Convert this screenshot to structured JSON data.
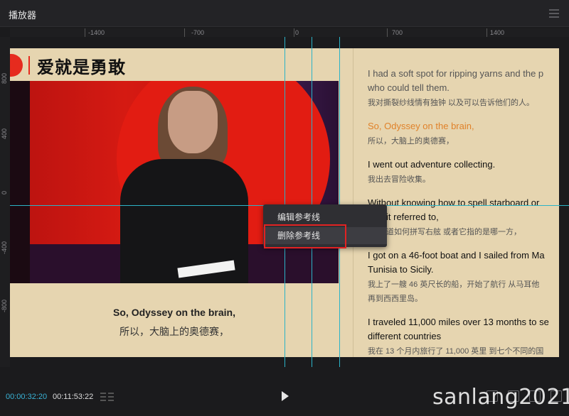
{
  "window": {
    "title": "播放器"
  },
  "ruler": {
    "top_ticks": [
      "-1400",
      "-700",
      "0",
      "700",
      "1400"
    ],
    "left_ticks": [
      "800",
      "400",
      "0",
      "-400",
      "-800"
    ]
  },
  "video": {
    "heading": "爱就是勇敢",
    "subtitle_en": "So, Odyssey on the brain,",
    "subtitle_zh": "所以，大脑上的奥德赛，"
  },
  "transcript": [
    {
      "en": "I had a soft spot for ripping yarns and the p",
      "en2": "who could tell them.",
      "zh": "我对撕裂纱线情有独钟 以及可以告诉他们的人。",
      "state": "dim"
    },
    {
      "en": "So, Odyssey on the brain,",
      "zh": "所以，大脑上的奥德赛，",
      "state": "active"
    },
    {
      "en": "I went out adventure collecting.",
      "zh": "我出去冒险收集。",
      "state": "normal"
    },
    {
      "en": "Without knowing how to spell starboard or",
      "en2": "it referred to,",
      "zh": "道如何拼写右舷 或者它指的是哪一方，",
      "state": "normal"
    },
    {
      "en": "I got on a 46-foot boat and I sailed from Ma",
      "en2": "Tunisia to Sicily.",
      "zh": "我上了一艘 46 英尺长的船，开始了航行 从马耳他",
      "zh2": "再到西西里岛。",
      "state": "normal"
    },
    {
      "en": "I traveled 11,000 miles over 13 months to se",
      "en2": "different countries",
      "zh": "我在 13 个月内旅行了 11,000 英里 到七个不同的国",
      "state": "normal"
    }
  ],
  "context_menu": {
    "items": [
      "编辑参考线",
      "删除参考线"
    ],
    "highlighted_index": 1
  },
  "playback": {
    "current_time": "00:00:32:20",
    "total_time": "00:11:53:22"
  },
  "watermark": "sanlang2021",
  "colors": {
    "accent": "#39b3d6",
    "guide": "#2bb3c7",
    "highlight_box": "#e22222",
    "active_line": "#e0822a",
    "stage_bg": "#e6d5b0"
  }
}
